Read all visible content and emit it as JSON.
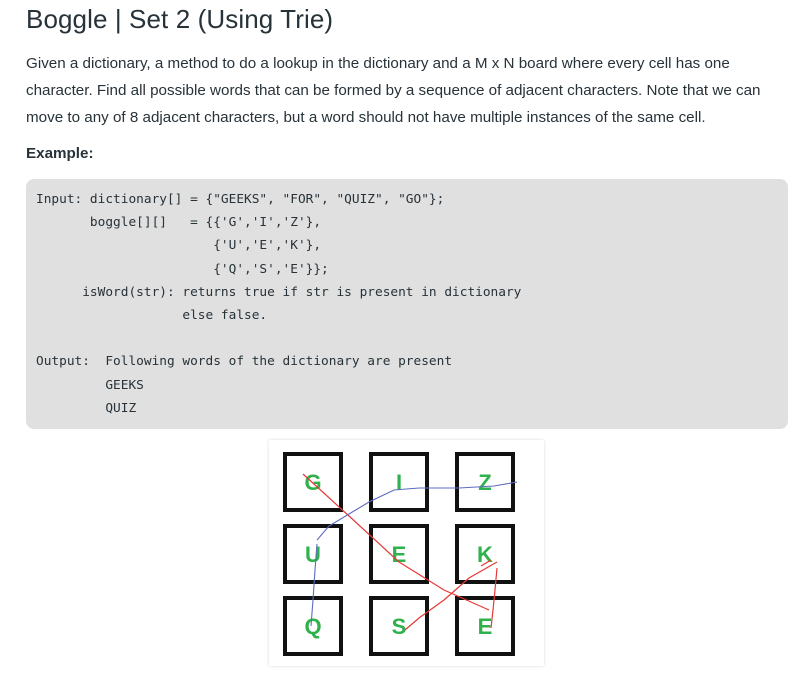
{
  "title": "Boggle | Set 2 (Using Trie)",
  "description": "Given a dictionary, a method to do a lookup in the dictionary and a M x N board where every cell has one character. Find all possible words that can be formed by a sequence of adjacent characters. Note that we can move to any of 8 adjacent characters, but a word should not have multiple instances of the same cell.",
  "example_label": "Example:",
  "code_lines": [
    "Input: dictionary[] = {\"GEEKS\", \"FOR\", \"QUIZ\", \"GO\"};",
    "       boggle[][]   = {{'G','I','Z'},",
    "                       {'U','E','K'},",
    "                       {'Q','S','E'}};",
    "      isWord(str): returns true if str is present in dictionary",
    "                   else false.",
    "",
    "Output:  Following words of the dictionary are present",
    "         GEEKS",
    "         QUIZ"
  ],
  "board": {
    "rows": [
      [
        "G",
        "I",
        "Z"
      ],
      [
        "U",
        "E",
        "K"
      ],
      [
        "Q",
        "S",
        "E"
      ]
    ],
    "letter_color": "#2fb24c",
    "geeks_path_color": "#e53935",
    "quiz_path_color": "#5c6bc0"
  }
}
